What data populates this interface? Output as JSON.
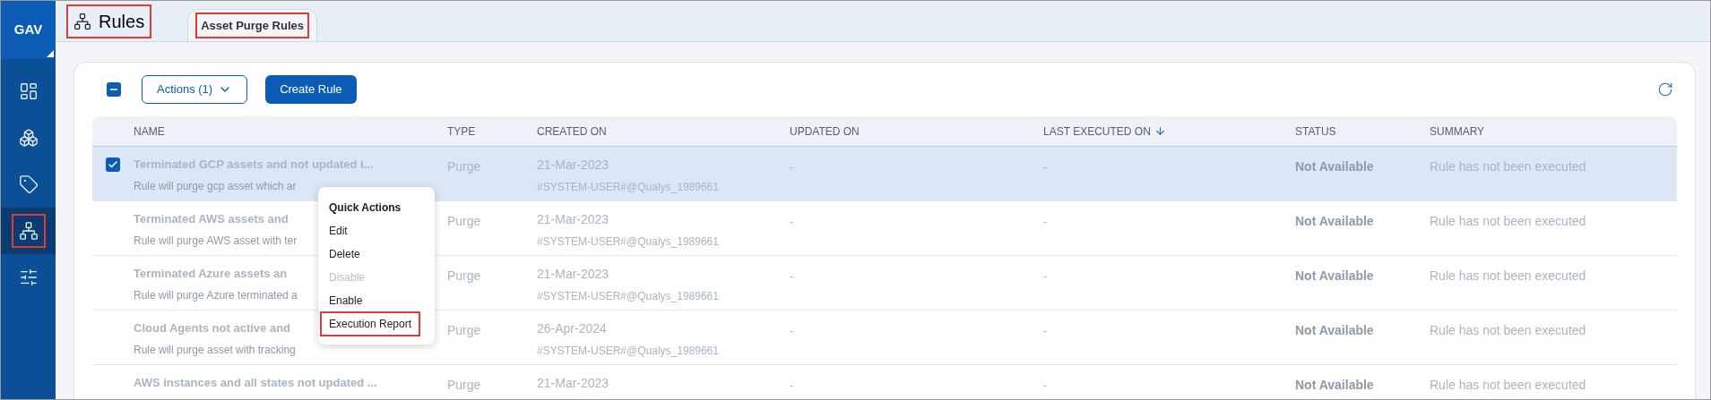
{
  "app": {
    "badge": "GAV"
  },
  "sidebar": {
    "items": [
      {
        "kind": "dashboard",
        "selected": false,
        "highlighted": false
      },
      {
        "kind": "assets",
        "selected": false,
        "highlighted": false
      },
      {
        "kind": "tag",
        "selected": false,
        "highlighted": false
      },
      {
        "kind": "rules",
        "selected": true,
        "highlighted": true
      },
      {
        "kind": "settings",
        "selected": false,
        "highlighted": false
      }
    ]
  },
  "header": {
    "title": "Rules",
    "highlighted": true
  },
  "tabs": [
    {
      "label": "Asset Purge Rules",
      "selected": true,
      "highlighted": true
    }
  ],
  "toolbar": {
    "select_all_indeterminate": true,
    "actions_button": "Actions (1)",
    "create_button": "Create Rule"
  },
  "table": {
    "columns": [
      {
        "label": "NAME",
        "sorted": false
      },
      {
        "label": "TYPE",
        "sorted": false
      },
      {
        "label": "CREATED ON",
        "sorted": false
      },
      {
        "label": "UPDATED ON",
        "sorted": false
      },
      {
        "label": "LAST EXECUTED ON",
        "sorted": true
      },
      {
        "label": "STATUS",
        "sorted": false
      },
      {
        "label": "SUMMARY",
        "sorted": false
      }
    ],
    "rows": [
      {
        "selected": true,
        "name": "Terminated GCP assets and not updated i...",
        "description": "Rule will purge gcp asset which ar",
        "type": "Purge",
        "created_on": "21-Mar-2023",
        "created_by": "#SYSTEM-USER#@Qualys_1989661",
        "updated_on": "-",
        "last_executed_on": "-",
        "status": "Not Available",
        "summary": "Rule has not been executed"
      },
      {
        "selected": false,
        "name": "Terminated AWS assets and",
        "description": "Rule will purge AWS asset with ter",
        "type": "Purge",
        "created_on": "21-Mar-2023",
        "created_by": "#SYSTEM-USER#@Qualys_1989661",
        "updated_on": "-",
        "last_executed_on": "-",
        "status": "Not Available",
        "summary": "Rule has not been executed"
      },
      {
        "selected": false,
        "name": "Terminated Azure assets an",
        "description": "Rule will purge Azure terminated a",
        "type": "Purge",
        "created_on": "21-Mar-2023",
        "created_by": "#SYSTEM-USER#@Qualys_1989661",
        "updated_on": "-",
        "last_executed_on": "-",
        "status": "Not Available",
        "summary": "Rule has not been executed"
      },
      {
        "selected": false,
        "name": "Cloud Agents not active and",
        "description": "Rule will purge asset with tracking",
        "type": "Purge",
        "created_on": "26-Apr-2024",
        "created_by": "#SYSTEM-USER#@Qualys_1989661",
        "updated_on": "-",
        "last_executed_on": "-",
        "status": "Not Available",
        "summary": "Rule has not been executed"
      },
      {
        "selected": false,
        "name": "AWS instances and all states not updated ...",
        "type": "Purge",
        "created_on": "21-Mar-2023",
        "updated_on": "-",
        "last_executed_on": "-",
        "status": "Not Available",
        "summary": "Rule has not been executed"
      }
    ]
  },
  "context_menu": {
    "title": "Quick Actions",
    "items": [
      {
        "label": "Edit",
        "disabled": false,
        "highlighted": false
      },
      {
        "label": "Delete",
        "disabled": false,
        "highlighted": false
      },
      {
        "label": "Disable",
        "disabled": true,
        "highlighted": false
      },
      {
        "label": "Enable",
        "disabled": false,
        "highlighted": false
      },
      {
        "label": "Execution Report",
        "disabled": false,
        "highlighted": true
      }
    ]
  }
}
